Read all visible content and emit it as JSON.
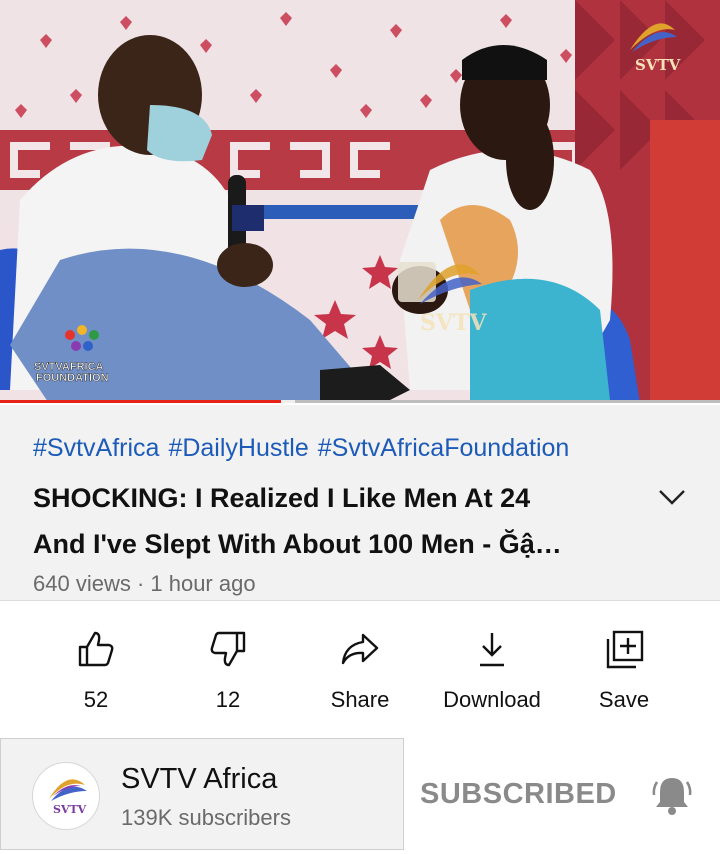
{
  "video": {
    "watermark_top": "SVTV",
    "watermark_center": "SVTV",
    "foundation_logo_line1": "SVTVAFRICA",
    "foundation_logo_line2": "FOUNDATION",
    "progress_fraction": 0.39,
    "buffer_fraction": 0.41,
    "accent_color": "#e62117"
  },
  "description": {
    "hashtags": [
      "#SvtvAfrica",
      "#DailyHustle",
      "#SvtvAfricaFoundation"
    ],
    "title_line1": "SHOCKING: I Realized I Like Men At 24",
    "title_line2": "And I've Slept With About 100 Men - Ğậ…",
    "meta": "640 views · 1 hour ago",
    "expand_icon": "chevron-down-icon",
    "hashtag_color": "#1d5bb8"
  },
  "actions": [
    {
      "label": "52",
      "icon": "thumbs-up-icon"
    },
    {
      "label": "12",
      "icon": "thumbs-down-icon"
    },
    {
      "label": "Share",
      "icon": "share-icon"
    },
    {
      "label": "Download",
      "icon": "download-icon"
    },
    {
      "label": "Save",
      "icon": "save-to-playlist-icon"
    }
  ],
  "channel": {
    "name": "SVTV Africa",
    "subscribers": "139K subscribers",
    "avatar_text": "SVTV",
    "subscribe_state": "SUBSCRIBED",
    "bell_icon": "notification-bell-icon"
  }
}
